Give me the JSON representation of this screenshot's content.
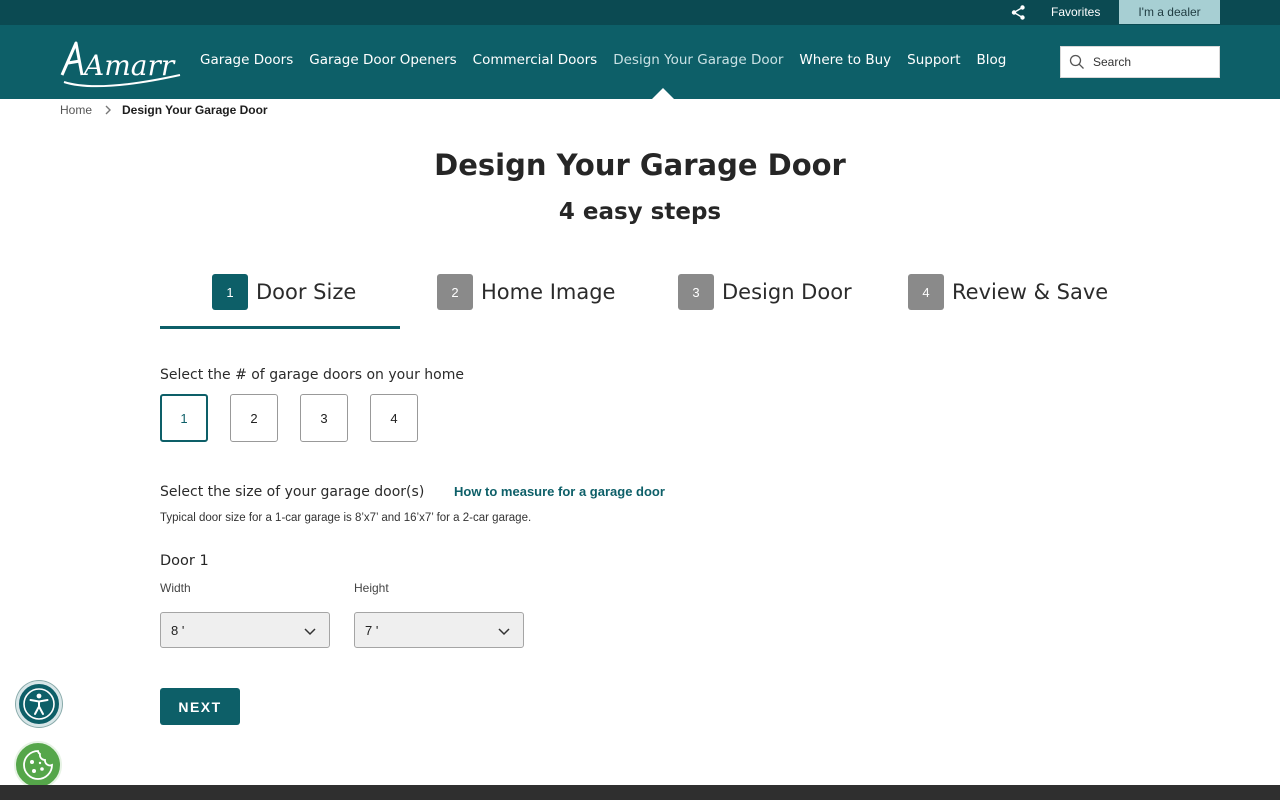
{
  "utility": {
    "favorites_label": "Favorites",
    "dealer_label": "I'm a dealer",
    "share_icon": "share-icon"
  },
  "brand": {
    "logo_text": "Amarr"
  },
  "nav": {
    "items": [
      {
        "label": "Garage Doors",
        "active": false
      },
      {
        "label": "Garage Door Openers",
        "active": false
      },
      {
        "label": "Commercial Doors",
        "active": false
      },
      {
        "label": "Design Your Garage Door",
        "active": true
      },
      {
        "label": "Where to Buy",
        "active": false
      },
      {
        "label": "Support",
        "active": false
      },
      {
        "label": "Blog",
        "active": false
      }
    ],
    "search_placeholder": "Search"
  },
  "breadcrumb": {
    "home": "Home",
    "current": "Design Your Garage Door"
  },
  "page": {
    "title": "Design Your Garage Door",
    "subtitle": "4 easy steps"
  },
  "steps": [
    {
      "num": "1",
      "label": "Door Size",
      "active": true
    },
    {
      "num": "2",
      "label": "Home Image",
      "active": false
    },
    {
      "num": "3",
      "label": "Design Door",
      "active": false
    },
    {
      "num": "4",
      "label": "Review & Save",
      "active": false
    }
  ],
  "door_count": {
    "label": "Select the # of garage doors on your home",
    "options": [
      "1",
      "2",
      "3",
      "4"
    ],
    "selected": "1"
  },
  "size": {
    "label": "Select the size of your garage door(s)",
    "measure_link": "How to measure for a garage door",
    "helper": "Typical door size for a 1-car garage is 8’x7’ and 16’x7’ for a 2-car garage."
  },
  "door1": {
    "label": "Door 1",
    "width_label": "Width",
    "width_value": "8 '",
    "height_label": "Height",
    "height_value": "7 '"
  },
  "next_label": "NEXT",
  "colors": {
    "brand_teal": "#0d5f68",
    "utility_bar": "#0b4a52",
    "dealer_bg": "#a7cfd3",
    "inactive_step": "#8a8a8a",
    "cookie_green": "#55a64a"
  }
}
